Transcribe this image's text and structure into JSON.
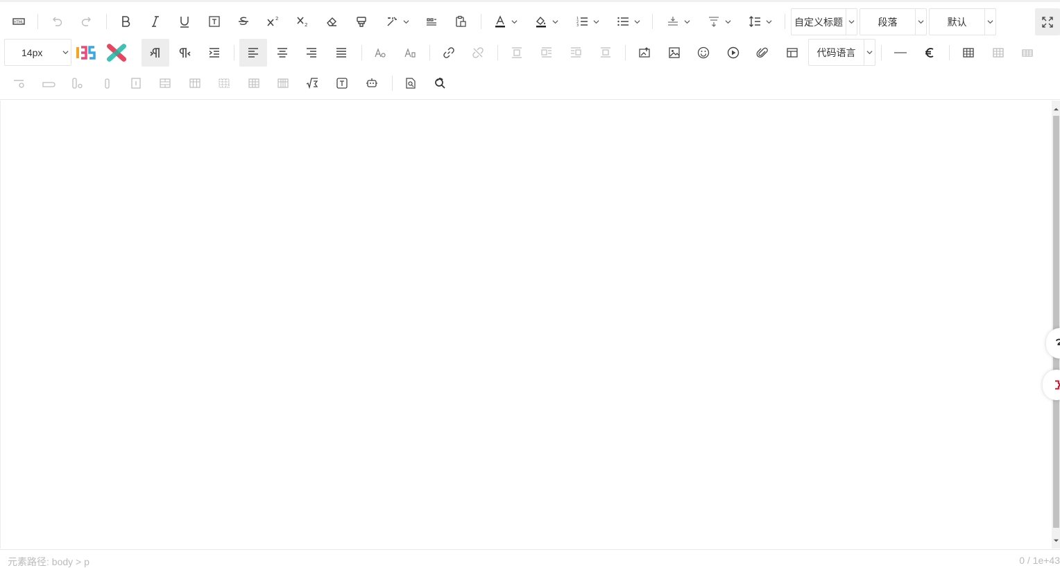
{
  "toolbar": {
    "font_size": "14px",
    "custom_heading": "自定义标题",
    "paragraph": "段落",
    "font_family": "默认",
    "code_language": "代码语言"
  },
  "icons": {
    "source": "html-source-icon",
    "undo": "undo-icon",
    "redo": "redo-icon",
    "bold": "bold-icon",
    "italic": "italic-icon",
    "underline": "underline-icon",
    "textbox": "text-border-icon",
    "strike": "strikethrough-icon",
    "sup": "superscript-icon",
    "sub": "subscript-icon",
    "eraser": "eraser-icon",
    "format_painter": "format-painter-icon",
    "autotype": "auto-typeset-icon",
    "quote": "blockquote-icon",
    "paste": "paste-plain-icon",
    "font_color": "font-color-icon",
    "bg_color": "background-color-icon",
    "ordered_list": "ordered-list-icon",
    "unordered_list": "unordered-list-icon",
    "row_spacing_top": "row-spacing-top-icon",
    "row_spacing_bottom": "row-spacing-bottom-icon",
    "line_height": "line-height-icon",
    "fullscreen": "fullscreen-icon"
  },
  "status": {
    "element_path": "元素路径: body > p",
    "word_count": "0 / 1e+43"
  },
  "colors": {
    "icon": "#444444",
    "disabled_icon": "#bbbbbb",
    "border": "#e4e4e4",
    "accent_red": "#e0001b"
  }
}
